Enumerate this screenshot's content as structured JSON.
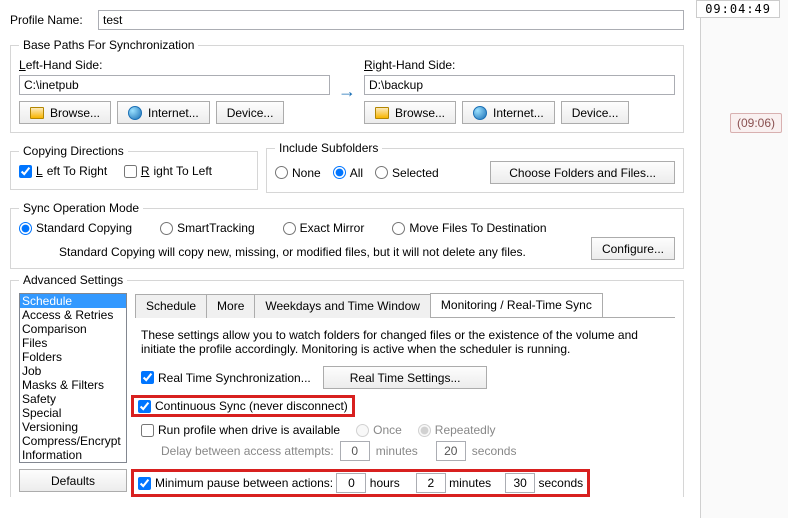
{
  "clock": "09:04:49",
  "bubble": "(09:06)",
  "profile": {
    "label": "Profile Name:",
    "value": "test"
  },
  "basePaths": {
    "legend": "Base Paths For Synchronization",
    "leftLabel": "Left-Hand Side:",
    "leftValue": "C:\\inetpub",
    "rightLabel": "Right-Hand Side:",
    "rightValue": "D:\\backup",
    "browse": "Browse...",
    "internet": "Internet...",
    "device": "Device..."
  },
  "copyDir": {
    "legend": "Copying Directions",
    "ltr": "Left To Right",
    "rtl": "Right To Left"
  },
  "subfolders": {
    "legend": "Include Subfolders",
    "none": "None",
    "all": "All",
    "selected": "Selected",
    "choose": "Choose Folders and Files..."
  },
  "syncMode": {
    "legend": "Sync Operation Mode",
    "standard": "Standard Copying",
    "smart": "SmartTracking",
    "exact": "Exact Mirror",
    "move": "Move Files To Destination",
    "configure": "Configure...",
    "desc": "Standard Copying will copy new, missing, or modified files, but it will not delete any files."
  },
  "adv": {
    "legend": "Advanced Settings",
    "items": [
      "Schedule",
      "Access & Retries",
      "Comparison",
      "Files",
      "Folders",
      "Job",
      "Masks & Filters",
      "Safety",
      "Special",
      "Versioning",
      "Compress/Encrypt",
      "Information"
    ],
    "defaults": "Defaults"
  },
  "tabs": {
    "schedule": "Schedule",
    "more": "More",
    "weekdays": "Weekdays and Time Window",
    "monitoring": "Monitoring / Real-Time Sync"
  },
  "mon": {
    "intro": "These settings allow you to watch folders for changed files or the existence of the volume and initiate the profile accordingly. Monitoring is active when the scheduler is running.",
    "rts": "Real Time Synchronization...",
    "rtsBtn": "Real Time Settings...",
    "cont": "Continuous Sync (never disconnect)",
    "drive": "Run profile when drive is available",
    "once": "Once",
    "rep": "Repeatedly",
    "delayLbl": "Delay between access attempts:",
    "delayMin": "0",
    "delayMinU": "minutes",
    "delaySec": "20",
    "delaySecU": "seconds",
    "pause": "Minimum pause between actions:",
    "ph": "0",
    "phU": "hours",
    "pm": "2",
    "pmU": "minutes",
    "ps": "30",
    "psU": "seconds"
  }
}
